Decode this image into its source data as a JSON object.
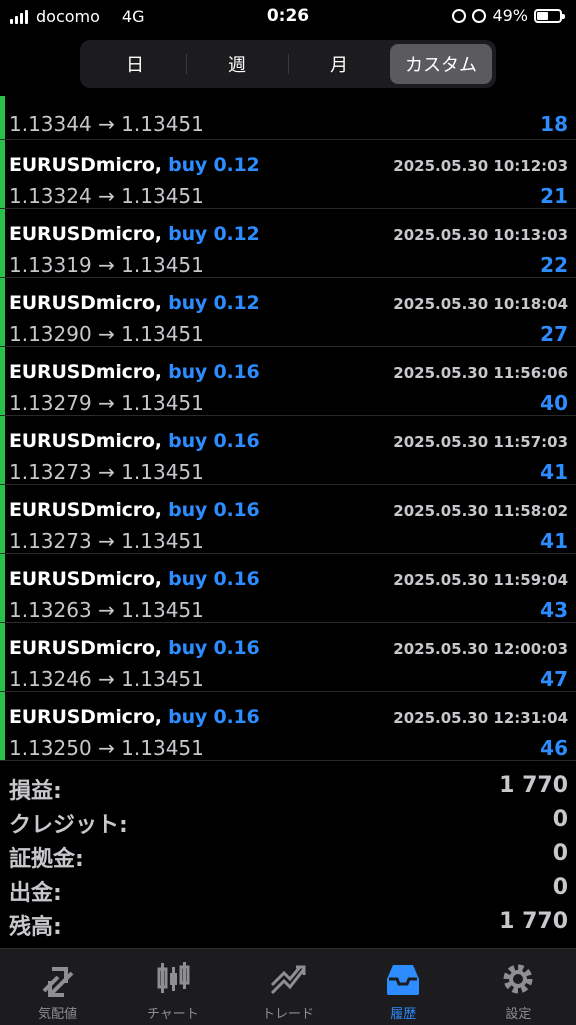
{
  "status_bar": {
    "carrier": "docomo",
    "network": "4G",
    "time": "0:26",
    "battery": "49%",
    "battery_level": 0.49
  },
  "segmented": [
    {
      "label": "日",
      "active": false
    },
    {
      "label": "週",
      "active": false
    },
    {
      "label": "月",
      "active": false
    },
    {
      "label": "カスタム",
      "active": true
    }
  ],
  "partial_row": {
    "prices": "1.13344 → 1.13451",
    "profit": "18"
  },
  "trades": [
    {
      "symbol": "EURUSDmicro,",
      "side": "buy 0.12",
      "time": "2025.05.30 10:12:03",
      "prices": "1.13324 → 1.13451",
      "profit": "21"
    },
    {
      "symbol": "EURUSDmicro,",
      "side": "buy 0.12",
      "time": "2025.05.30 10:13:03",
      "prices": "1.13319 → 1.13451",
      "profit": "22"
    },
    {
      "symbol": "EURUSDmicro,",
      "side": "buy 0.12",
      "time": "2025.05.30 10:18:04",
      "prices": "1.13290 → 1.13451",
      "profit": "27"
    },
    {
      "symbol": "EURUSDmicro,",
      "side": "buy 0.16",
      "time": "2025.05.30 11:56:06",
      "prices": "1.13279 → 1.13451",
      "profit": "40"
    },
    {
      "symbol": "EURUSDmicro,",
      "side": "buy 0.16",
      "time": "2025.05.30 11:57:03",
      "prices": "1.13273 → 1.13451",
      "profit": "41"
    },
    {
      "symbol": "EURUSDmicro,",
      "side": "buy 0.16",
      "time": "2025.05.30 11:58:02",
      "prices": "1.13273 → 1.13451",
      "profit": "41"
    },
    {
      "symbol": "EURUSDmicro,",
      "side": "buy 0.16",
      "time": "2025.05.30 11:59:04",
      "prices": "1.13263 → 1.13451",
      "profit": "43"
    },
    {
      "symbol": "EURUSDmicro,",
      "side": "buy 0.16",
      "time": "2025.05.30 12:00:03",
      "prices": "1.13246 → 1.13451",
      "profit": "47"
    },
    {
      "symbol": "EURUSDmicro,",
      "side": "buy 0.16",
      "time": "2025.05.30 12:31:04",
      "prices": "1.13250 → 1.13451",
      "profit": "46"
    }
  ],
  "summary": [
    {
      "label": "損益:",
      "value": "1 770"
    },
    {
      "label": "クレジット:",
      "value": "0"
    },
    {
      "label": "証拠金:",
      "value": "0"
    },
    {
      "label": "出金:",
      "value": "0"
    },
    {
      "label": "残高:",
      "value": "1 770"
    }
  ],
  "tabbar": [
    {
      "label": "気配値",
      "icon": "quotes-icon",
      "active": false
    },
    {
      "label": "チャート",
      "icon": "chart-icon",
      "active": false
    },
    {
      "label": "トレード",
      "icon": "trade-icon",
      "active": false
    },
    {
      "label": "履歴",
      "icon": "history-icon",
      "active": true
    },
    {
      "label": "設定",
      "icon": "gear-icon",
      "active": false
    }
  ],
  "colors": {
    "accent": "#2d8cff",
    "buy_bar": "#27c24c",
    "background": "#000000"
  }
}
